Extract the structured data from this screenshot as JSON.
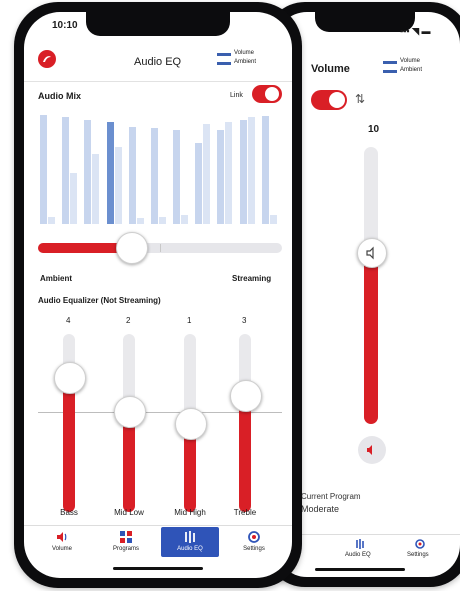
{
  "front": {
    "status_time": "10:10",
    "header_title": "Audio EQ",
    "legend": [
      {
        "label": "Volume",
        "color": "#3a5fae"
      },
      {
        "label": "Ambient",
        "color": "#3a5fae"
      }
    ],
    "audio_mix_label": "Audio Mix",
    "link_label": "Link",
    "link_on": true,
    "mix_bars": [
      {
        "tall": 0.94,
        "short": 0.06
      },
      {
        "tall": 0.92,
        "short": 0.44
      },
      {
        "tall": 0.9,
        "short": 0.6
      },
      {
        "tall": 0.88,
        "short": 0.66
      },
      {
        "tall": 0.84,
        "short": 0.05
      },
      {
        "tall": 0.83,
        "short": 0.06
      },
      {
        "tall": 0.81,
        "short": 0.08
      },
      {
        "tall": 0.7,
        "short": 0.86
      },
      {
        "tall": 0.81,
        "short": 0.88
      },
      {
        "tall": 0.9,
        "short": 0.92
      },
      {
        "tall": 0.93,
        "short": 0.08
      }
    ],
    "mix_highlight_index": 3,
    "mix_level": 0.38,
    "ambient_label": "Ambient",
    "streaming_label": "Streaming",
    "eq_title": "Audio Equalizer (Not Streaming)",
    "eq": [
      {
        "name": "Bass",
        "value": "4",
        "level": 0.76
      },
      {
        "name": "Mid Low",
        "value": "2",
        "level": 0.57
      },
      {
        "name": "Mid High",
        "value": "1",
        "level": 0.5
      },
      {
        "name": "Treble",
        "value": "3",
        "level": 0.66
      }
    ],
    "tabs": [
      {
        "label": "Volume",
        "icon": "speaker-icon",
        "active": false
      },
      {
        "label": "Programs",
        "icon": "grid-icon",
        "active": false
      },
      {
        "label": "Audio EQ",
        "icon": "equalizer-icon",
        "active": true
      },
      {
        "label": "Settings",
        "icon": "gear-icon",
        "active": false
      }
    ]
  },
  "back": {
    "header_title": "Volume",
    "legend": [
      {
        "label": "Volume",
        "color": "#3a5fae"
      },
      {
        "label": "Ambient",
        "color": "#3a5fae"
      }
    ],
    "volume_value": "10",
    "volume_level": 0.62,
    "program_label": "Current Program",
    "program_value": "Moderate",
    "tabs": [
      {
        "label": "Audio EQ",
        "icon": "equalizer-icon"
      },
      {
        "label": "Settings",
        "icon": "gear-icon"
      }
    ]
  },
  "colors": {
    "accent": "#d91f26",
    "active_tab": "#2f54b8",
    "bar_dark": "#6b8fcf",
    "bar_light": "#c7d5ee"
  }
}
